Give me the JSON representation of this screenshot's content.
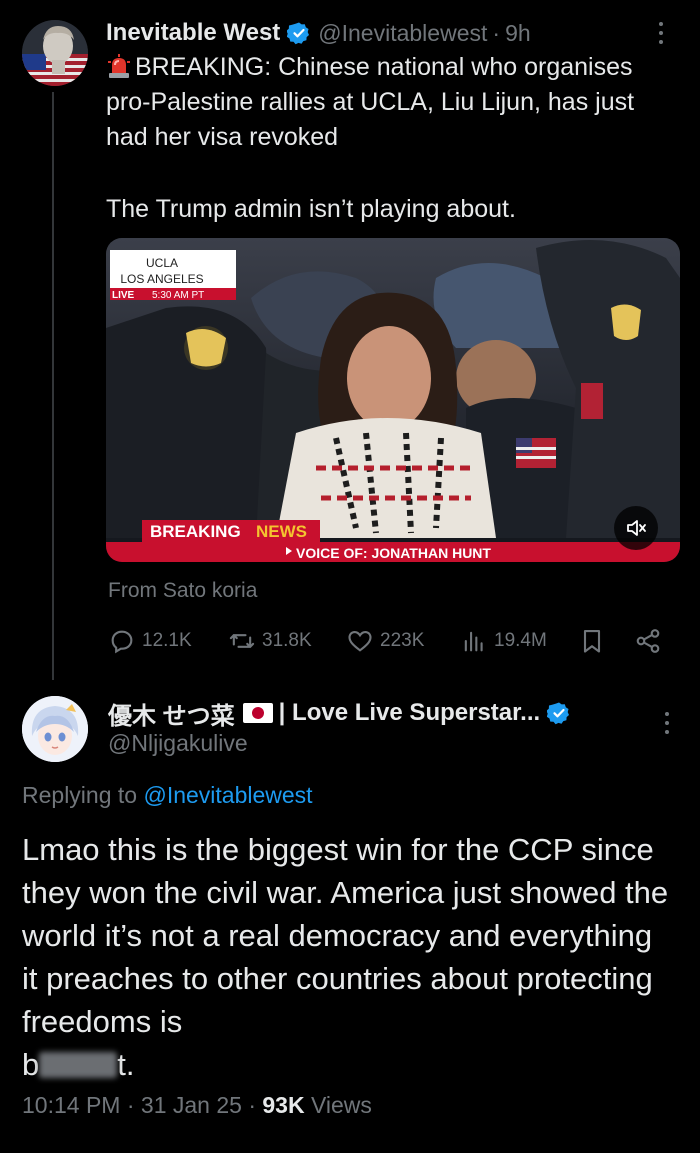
{
  "tweet1": {
    "author_name": "Inevitable West",
    "handle": "@Inevitablewest",
    "separator": "·",
    "time": "9h",
    "text_line1": "BREAKING: Chinese national who organises pro-Palestine rallies at UCLA, Liu Lijun, has just had her visa revoked",
    "text_line2": "The Trump admin isn’t playing about.",
    "icons": {
      "siren": "police-siren-icon",
      "verified": "verified-badge-icon",
      "more": "more-dots-icon"
    },
    "media": {
      "location_line1": "UCLA",
      "location_line2": "LOS ANGELES",
      "live_label": "LIVE",
      "live_time": "5:30 AM PT",
      "banner": "BREAKING",
      "banner_highlight": "NEWS",
      "ticker": "VOICE OF: JONATHAN HUNT"
    },
    "source_note": "From Sato koria",
    "stats": {
      "replies": "12.1K",
      "reposts": "31.8K",
      "likes": "223K",
      "views": "19.4M"
    }
  },
  "tweet2": {
    "author_name": "優木 せつ菜",
    "author_name_suffix": "| Love Live Superstar...",
    "handle": "@Nljigakulive",
    "replying_prefix": "Replying to",
    "replying_to": "@Inevitablewest",
    "text_main": "Lmao this is the biggest win for the CCP since they won the civil war. America just showed the world it’s not a real democracy and everything it preaches to other countries about protecting freedoms is",
    "text_end_start": "b",
    "text_end_finish": "t.",
    "time": "10:14 PM",
    "date": "31 Jan 25",
    "dot": "·",
    "views_count": "93K",
    "views_label": "Views"
  },
  "colors": {
    "background": "#000000",
    "text": "#e7e9ea",
    "muted": "#71767b",
    "accent": "#1d9bf0",
    "news_red": "#c8102e"
  }
}
